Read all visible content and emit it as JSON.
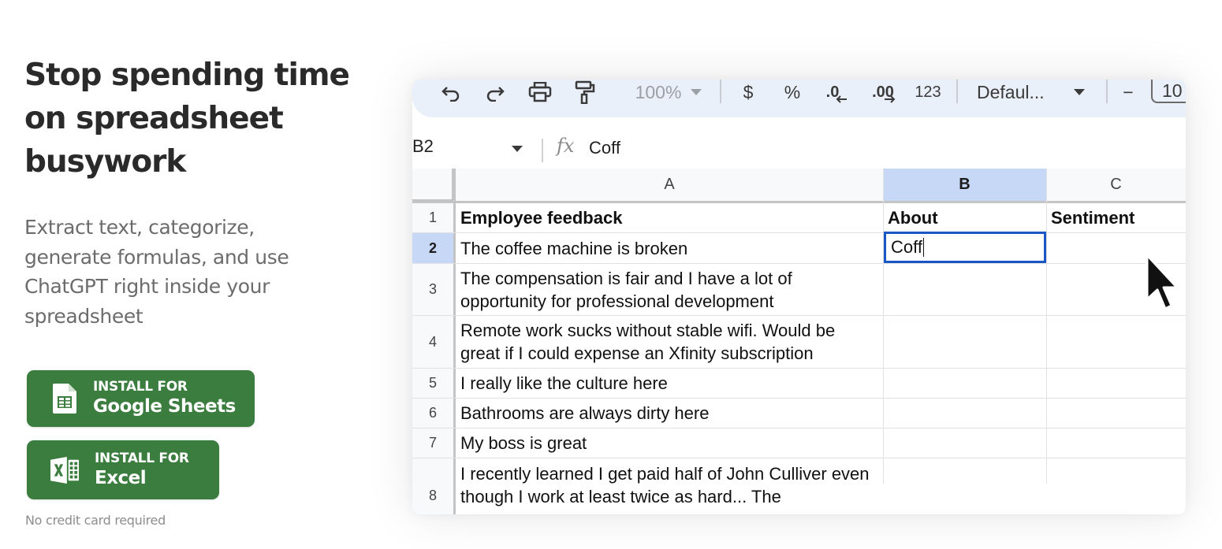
{
  "hero": {
    "title_lines": [
      "Stop spending time",
      "on spreadsheet",
      "busywork"
    ],
    "subtitle_lines": [
      "Extract text, categorize,",
      "generate formulas, and use",
      "ChatGPT right inside your",
      "spreadsheet"
    ]
  },
  "buttons": {
    "sheets": {
      "small": "INSTALL FOR",
      "big": "Google Sheets",
      "icon": "google-sheets-icon"
    },
    "excel": {
      "small": "INSTALL FOR",
      "big": "Excel",
      "icon": "excel-icon"
    }
  },
  "footnote": "No credit card required",
  "toolbar": {
    "zoom": "100%",
    "currency": "$",
    "percent": "%",
    "decrease_decimal": ".0",
    "increase_decimal": ".00",
    "number_format": "123",
    "font": "Defaul...",
    "minus": "−",
    "font_size": "10"
  },
  "formula_bar": {
    "cell_ref": "B2",
    "fx": "fx",
    "value": "Coff"
  },
  "sheet": {
    "columns": [
      "A",
      "B",
      "C"
    ],
    "rows": [
      {
        "num": "1",
        "a": "Employee feedback",
        "b": "About",
        "c": "Sentiment"
      },
      {
        "num": "2",
        "a": "The coffee machine is broken",
        "b": "Coff",
        "c": ""
      },
      {
        "num": "3",
        "a": "The compensation is fair and I have a lot of opportunity for professional development",
        "b": "",
        "c": ""
      },
      {
        "num": "4",
        "a": "Remote work sucks without stable wifi. Would be great if I could expense an Xfinity subscription",
        "b": "",
        "c": ""
      },
      {
        "num": "5",
        "a": "I really like the culture here",
        "b": "",
        "c": ""
      },
      {
        "num": "6",
        "a": "Bathrooms are always dirty here",
        "b": "",
        "c": ""
      },
      {
        "num": "7",
        "a": "My boss is great",
        "b": "",
        "c": ""
      },
      {
        "num": "8",
        "a": "I recently learned I get paid half of John Culliver even though I work at least twice as hard...  The",
        "b": "",
        "c": ""
      }
    ]
  },
  "colors": {
    "button_green": "#3b7d3e",
    "toolbar_bg": "#eaf0f9",
    "selected_header": "#c6d8f5",
    "edit_border": "#1a56c4"
  }
}
